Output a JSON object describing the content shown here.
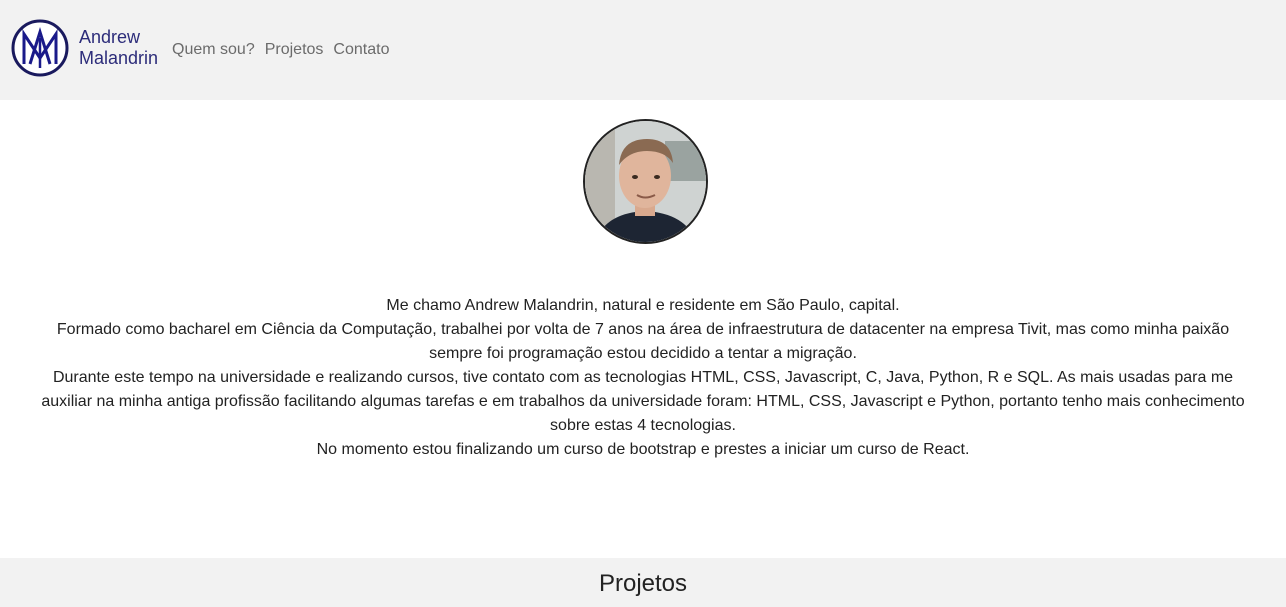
{
  "navbar": {
    "brand_line1": "Andrew",
    "brand_line2": "Malandrin",
    "links": [
      "Quem sou?",
      "Projetos",
      "Contato"
    ]
  },
  "avatar": {
    "icon": "profile-photo"
  },
  "about": {
    "paragraphs": [
      "Me chamo Andrew Malandrin, natural e residente em São Paulo, capital.",
      "Formado como bacharel em Ciência da Computação, trabalhei por volta de 7 anos na área de infraestrutura de datacenter na empresa Tivit, mas como minha paixão sempre foi programação estou decidido a tentar a migração.",
      "Durante este tempo na universidade e realizando cursos, tive contato com as tecnologias HTML, CSS, Javascript, C, Java, Python, R e SQL. As mais usadas para me auxiliar na minha antiga profissão facilitando algumas tarefas e em trabalhos da universidade foram: HTML, CSS, Javascript e Python, portanto tenho mais conhecimento sobre estas 4 tecnologias.",
      "No momento estou finalizando um curso de bootstrap e prestes a iniciar um curso de React."
    ]
  },
  "projects": {
    "title": "Projetos"
  },
  "colors": {
    "brand": "#2c2c7a",
    "band": "#f2f2f2"
  }
}
